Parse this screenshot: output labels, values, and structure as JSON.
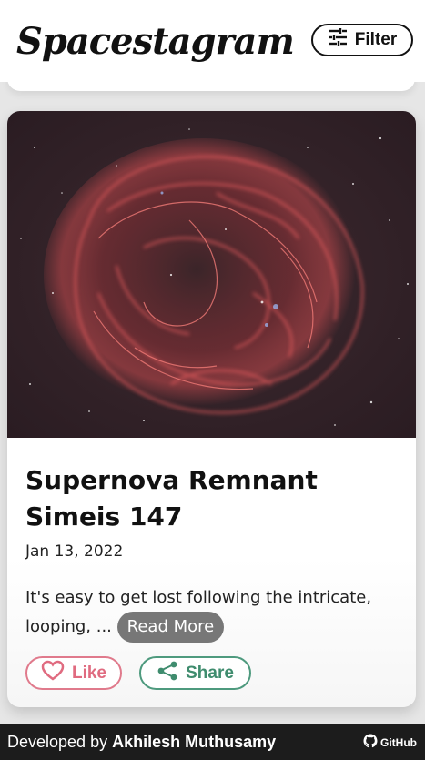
{
  "header": {
    "logo": "Spacestagram",
    "filter_label": "Filter"
  },
  "post": {
    "title": "Supernova Remnant Simeis 147",
    "date": "Jan 13, 2022",
    "description": "It's easy to get lost following the intricate, looping, ...",
    "read_more_label": "Read More",
    "like_label": "Like",
    "share_label": "Share",
    "image_alt": "Supernova Remnant Simeis 147"
  },
  "footer": {
    "developed_by": "Developed by",
    "author": "Akhilesh Muthusamy",
    "github_label": "GitHub"
  },
  "colors": {
    "like": "#e06b80",
    "share": "#3f8c6e",
    "read_more_bg": "#777777",
    "footer_bg": "#1c1c1c"
  }
}
